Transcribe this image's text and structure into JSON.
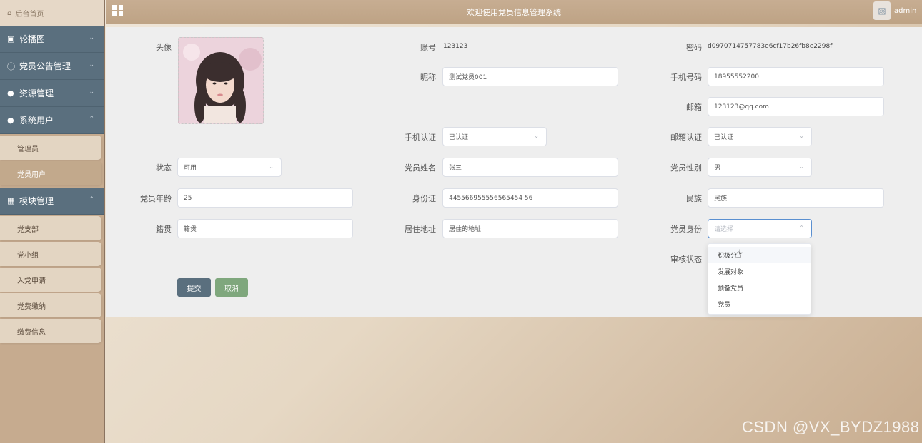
{
  "sidebar": {
    "home": "后台首页",
    "groups": [
      {
        "label": "轮播图",
        "icon": "image-icon",
        "chev": "⌄"
      },
      {
        "label": "党员公告管理",
        "icon": "info-icon",
        "chev": "⌄"
      },
      {
        "label": "资源管理",
        "icon": "bulb-icon",
        "chev": "⌄"
      },
      {
        "label": "系统用户",
        "icon": "user-icon",
        "chev": "⌃"
      },
      {
        "label": "模块管理",
        "icon": "grid-icon",
        "chev": "⌃"
      }
    ],
    "system_users": [
      "管理员",
      "党员用户"
    ],
    "modules": [
      "党支部",
      "党小组",
      "入党申请",
      "党费缴纳",
      "缴费信息"
    ]
  },
  "header": {
    "title": "欢迎使用党员信息管理系统",
    "user": "admin"
  },
  "form": {
    "avatar_label": "头像",
    "account_label": "账号",
    "account_value": "123123",
    "password_label": "密码",
    "password_value": "d0970714757783e6cf17b26fb8e2298f",
    "nickname_label": "昵称",
    "nickname_value": "测试党员001",
    "phone_label": "手机号码",
    "phone_value": "18955552200",
    "email_label": "邮箱",
    "email_value": "123123@qq.com",
    "phone_verify_label": "手机认证",
    "phone_verify_value": "已认证",
    "email_verify_label": "邮箱认证",
    "email_verify_value": "已认证",
    "status_label": "状态",
    "status_value": "可用",
    "name_label": "党员姓名",
    "name_value": "张三",
    "gender_label": "党员性别",
    "gender_value": "男",
    "age_label": "党员年龄",
    "age_value": "25",
    "idcard_label": "身份证",
    "idcard_value": "445566955556565454 56",
    "ethnic_label": "民族",
    "ethnic_value": "民族",
    "native_label": "籍贯",
    "native_value": "籍贯",
    "address_label": "居住地址",
    "address_value": "居住的地址",
    "identity_label": "党员身份",
    "identity_placeholder": "请选择",
    "review_label": "审核状态",
    "submit": "提交",
    "cancel": "取消"
  },
  "dropdown": {
    "options": [
      "积极分子",
      "发展对象",
      "预备党员",
      "党员"
    ]
  },
  "watermark": "CSDN @VX_BYDZ1988",
  "colors": {
    "sidebar_group": "#5a6f7e",
    "submit_btn": "#5a6f7e",
    "cancel_btn": "#7fa77d",
    "header": "#c7ad92"
  }
}
